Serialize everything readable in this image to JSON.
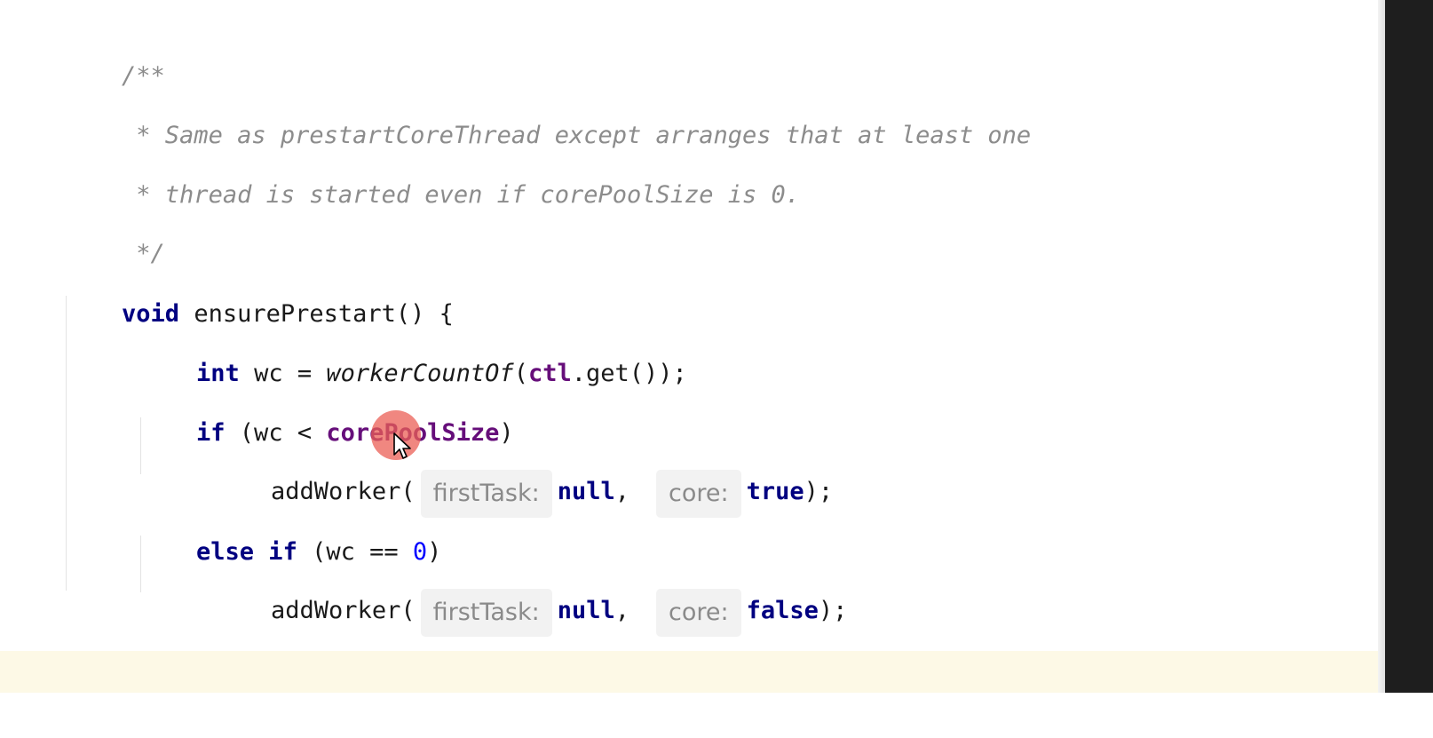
{
  "code": {
    "doc_open": "/**",
    "doc_line1": " * Same as prestartCoreThread except arranges that at least one",
    "doc_line2": " * thread is started even if corePoolSize is 0.",
    "doc_close": " */",
    "kw_void": "void",
    "method_sig": " ensurePrestart() {",
    "kw_int": "int",
    "wc_assign": " wc = ",
    "fn_worker_count_of": "workerCountOf",
    "paren_open": "(",
    "field_ctl": "ctl",
    "get_call": ".get());",
    "kw_if": "if",
    "if_cond_start": " (wc < ",
    "field_core_pool_size": "corePoolSize",
    "paren_close": ")",
    "add_worker_call": "addWorker(",
    "hint_first_task": "firstTask:",
    "kw_null": "null",
    "comma": ",",
    "hint_core": "core:",
    "kw_true": "true",
    "kw_false": "false",
    "call_end": ");",
    "kw_else_if": "else if",
    "else_cond_start": " (wc == ",
    "num_zero": "0",
    "closing_brace": "}"
  },
  "icons": {
    "cursor": "mouse-pointer-icon",
    "click_indicator": "click-highlight"
  },
  "colors": {
    "keyword": "#000080",
    "field": "#660e7a",
    "comment": "#8c8c8c",
    "number": "#0000ff",
    "hint_bg": "#f2f2f2",
    "click_highlight": "#eb5f55"
  }
}
